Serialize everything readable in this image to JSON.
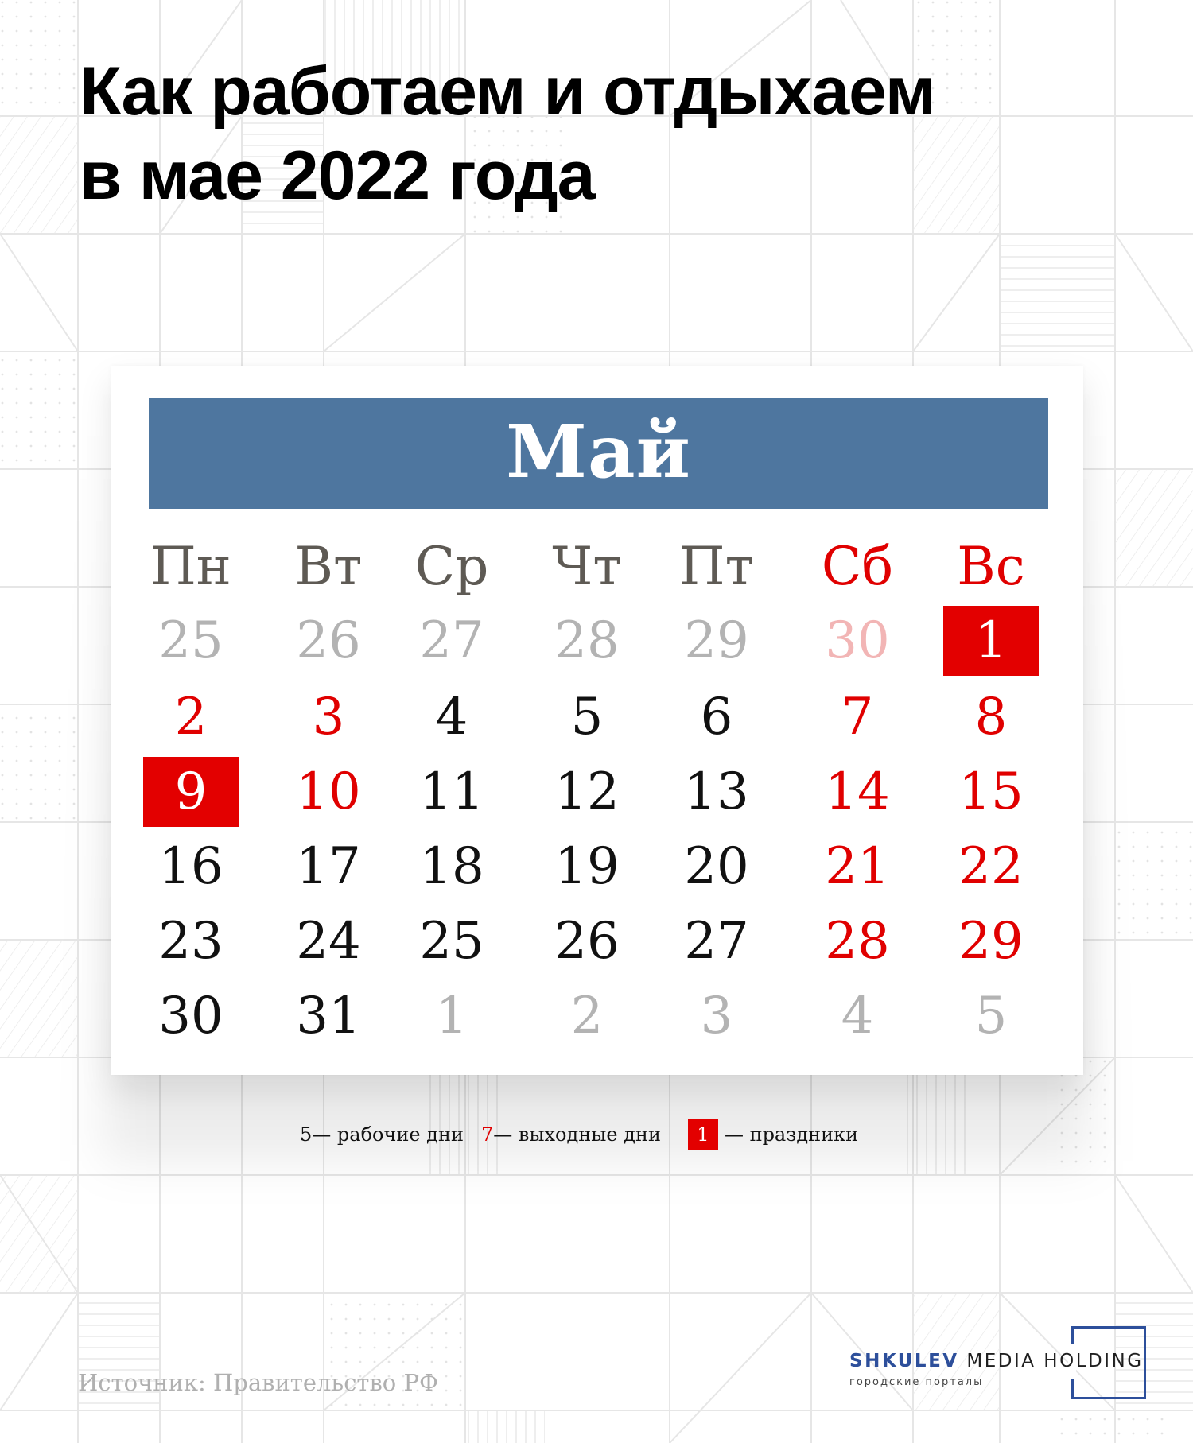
{
  "title": {
    "line1": "Как работаем и отдыхаем",
    "line2": "в мае 2022 года"
  },
  "calendar": {
    "month": "Май",
    "colors": {
      "header_bar": "#4e769f",
      "weekend_red": "#e00000",
      "holiday_fill": "#e30000",
      "weekday_header": "#5e5a54",
      "other_month_gray": "#b3b3b3"
    },
    "weekdays": [
      {
        "label": "Пн",
        "weekend": false
      },
      {
        "label": "Вт",
        "weekend": false
      },
      {
        "label": "Ср",
        "weekend": false
      },
      {
        "label": "Чт",
        "weekend": false
      },
      {
        "label": "Пт",
        "weekend": false
      },
      {
        "label": "Сб",
        "weekend": true
      },
      {
        "label": "Вс",
        "weekend": true
      }
    ],
    "weeks": [
      [
        {
          "d": "25",
          "type": "other"
        },
        {
          "d": "26",
          "type": "other"
        },
        {
          "d": "27",
          "type": "other"
        },
        {
          "d": "28",
          "type": "other"
        },
        {
          "d": "29",
          "type": "other"
        },
        {
          "d": "30",
          "type": "other-weekend"
        },
        {
          "d": "1",
          "type": "holiday"
        }
      ],
      [
        {
          "d": "2",
          "type": "weekend"
        },
        {
          "d": "3",
          "type": "weekend"
        },
        {
          "d": "4",
          "type": "work"
        },
        {
          "d": "5",
          "type": "work"
        },
        {
          "d": "6",
          "type": "work"
        },
        {
          "d": "7",
          "type": "weekend"
        },
        {
          "d": "8",
          "type": "weekend"
        }
      ],
      [
        {
          "d": "9",
          "type": "holiday"
        },
        {
          "d": "10",
          "type": "weekend"
        },
        {
          "d": "11",
          "type": "work"
        },
        {
          "d": "12",
          "type": "work"
        },
        {
          "d": "13",
          "type": "work"
        },
        {
          "d": "14",
          "type": "weekend"
        },
        {
          "d": "15",
          "type": "weekend"
        }
      ],
      [
        {
          "d": "16",
          "type": "work"
        },
        {
          "d": "17",
          "type": "work"
        },
        {
          "d": "18",
          "type": "work"
        },
        {
          "d": "19",
          "type": "work"
        },
        {
          "d": "20",
          "type": "work"
        },
        {
          "d": "21",
          "type": "weekend"
        },
        {
          "d": "22",
          "type": "weekend"
        }
      ],
      [
        {
          "d": "23",
          "type": "work"
        },
        {
          "d": "24",
          "type": "work"
        },
        {
          "d": "25",
          "type": "work"
        },
        {
          "d": "26",
          "type": "work"
        },
        {
          "d": "27",
          "type": "work"
        },
        {
          "d": "28",
          "type": "weekend"
        },
        {
          "d": "29",
          "type": "weekend"
        }
      ],
      [
        {
          "d": "30",
          "type": "work"
        },
        {
          "d": "31",
          "type": "work"
        },
        {
          "d": "1",
          "type": "other"
        },
        {
          "d": "2",
          "type": "other"
        },
        {
          "d": "3",
          "type": "other"
        },
        {
          "d": "4",
          "type": "other"
        },
        {
          "d": "5",
          "type": "other"
        }
      ]
    ]
  },
  "legend": {
    "work_sample": "5",
    "work_text": " — рабочие дни",
    "weekend_sample": "7",
    "weekend_text": " — выходные дни",
    "holiday_sample": "1",
    "holiday_text": "—  праздники"
  },
  "source": "Источник: Правительство РФ",
  "logo": {
    "brand": "SHKULEV",
    "rest": " MEDIA HOLDING",
    "subtitle": "городские порталы"
  }
}
